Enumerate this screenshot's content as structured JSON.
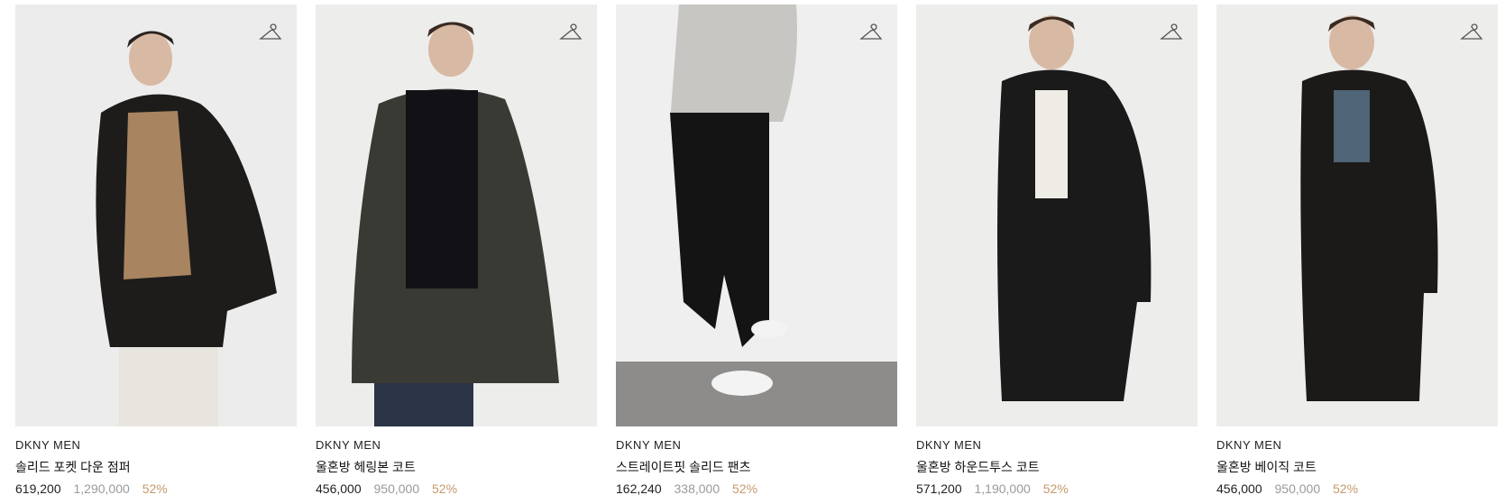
{
  "products": [
    {
      "brand": "DKNY MEN",
      "name": "솔리드 포켓 다운 점퍼",
      "sale_price": "619,200",
      "original_price": "1,290,000",
      "discount": "52%",
      "image": "model wearing black hooded down jacket, camel knit sweater and white trousers"
    },
    {
      "brand": "DKNY MEN",
      "name": "울혼방 헤링본 코트",
      "sale_price": "456,000",
      "original_price": "950,000",
      "discount": "52%",
      "image": "model wearing dark herringbone coat over black turtleneck and jeans"
    },
    {
      "brand": "DKNY MEN",
      "name": "스트레이트핏 솔리드 팬츠",
      "sale_price": "162,240",
      "original_price": "338,000",
      "discount": "52%",
      "image": "legs in black straight pants with white sneakers and grey sweater"
    },
    {
      "brand": "DKNY MEN",
      "name": "울혼방 하운드투스 코트",
      "sale_price": "571,200",
      "original_price": "1,190,000",
      "discount": "52%",
      "image": "model wearing long black houndstooth coat over white tee"
    },
    {
      "brand": "DKNY MEN",
      "name": "울혼방 베이직 코트",
      "sale_price": "456,000",
      "original_price": "950,000",
      "discount": "52%",
      "image": "model wearing long black basic coat over blue tee"
    }
  ],
  "icons": {
    "wishlist": "hanger-icon"
  },
  "colors": {
    "discount": "#c49a6c",
    "original_price": "#9a9a9a",
    "text": "#222222"
  }
}
